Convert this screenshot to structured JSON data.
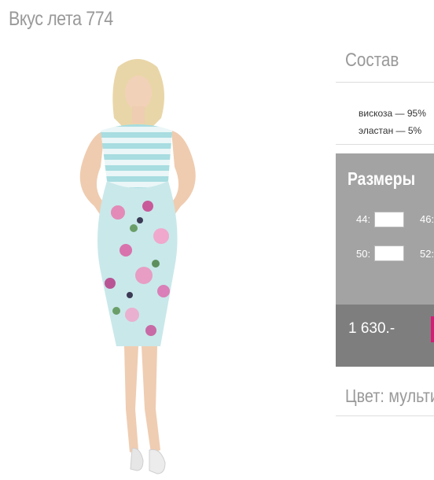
{
  "product": {
    "title": "Вкус лета 774"
  },
  "composition": {
    "heading": "Состав",
    "items": [
      "вискоза — 95%",
      "эластан — 5%"
    ]
  },
  "sizes": {
    "heading": "Размеры",
    "options": [
      {
        "label": "44:",
        "value": ""
      },
      {
        "label": "46:",
        "value": ""
      },
      {
        "label": "50:",
        "value": ""
      },
      {
        "label": "52:",
        "value": ""
      }
    ]
  },
  "price": {
    "value": "1 630.-"
  },
  "color": {
    "heading": "Цвет: мульти"
  },
  "colors": {
    "brand": "#d81b75",
    "panel_sizes": "#a3a3a3",
    "panel_price": "#7e7e7e",
    "text_gray": "#999999"
  }
}
